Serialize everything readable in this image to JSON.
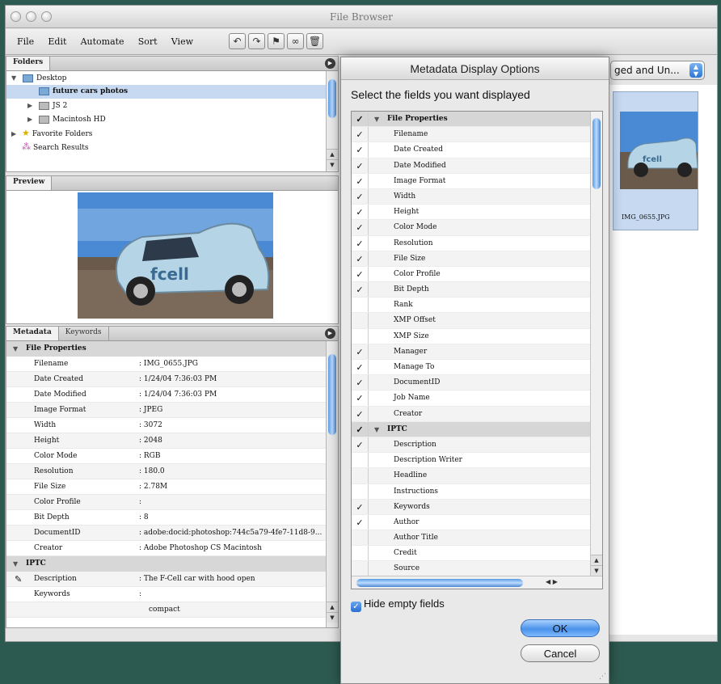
{
  "window": {
    "title": "File Browser"
  },
  "menu": [
    "File",
    "Edit",
    "Automate",
    "Sort",
    "View"
  ],
  "toolbar": {
    "icons": [
      "rotate-ccw-icon",
      "rotate-cw-icon",
      "flag-icon",
      "binoculars-icon",
      "trash-icon"
    ]
  },
  "folders": {
    "tab": "Folders",
    "items": [
      {
        "label": "Desktop",
        "expanded": true,
        "icon": "folder-icon"
      },
      {
        "label": "future cars photos",
        "selected": true,
        "icon": "folder-icon"
      },
      {
        "label": "JS 2",
        "icon": "disk-icon"
      },
      {
        "label": "Macintosh HD",
        "icon": "disk-icon"
      },
      {
        "label": "Favorite Folders",
        "icon": "star-icon"
      },
      {
        "label": "Search Results",
        "icon": "search-results-icon"
      }
    ]
  },
  "preview": {
    "tab": "Preview"
  },
  "metadata": {
    "tabs": [
      "Metadata",
      "Keywords"
    ],
    "group_file": "File Properties",
    "rows": [
      {
        "key": "Filename",
        "value": ": IMG_0655.JPG"
      },
      {
        "key": "Date Created",
        "value": ": 1/24/04 7:36:03 PM"
      },
      {
        "key": "Date Modified",
        "value": ": 1/24/04 7:36:03 PM"
      },
      {
        "key": "Image Format",
        "value": ": JPEG"
      },
      {
        "key": "Width",
        "value": ": 3072"
      },
      {
        "key": "Height",
        "value": ": 2048"
      },
      {
        "key": "Color Mode",
        "value": ": RGB"
      },
      {
        "key": "Resolution",
        "value": ": 180.0"
      },
      {
        "key": "File Size",
        "value": ": 2.78M"
      },
      {
        "key": "Color Profile",
        "value": ":"
      },
      {
        "key": "Bit Depth",
        "value": ": 8"
      },
      {
        "key": "DocumentID",
        "value": ": adobe:docid:photoshop:744c5a79-4fe7-11d8-9..."
      },
      {
        "key": "Creator",
        "value": ": Adobe Photoshop CS Macintosh"
      }
    ],
    "group_iptc": "IPTC",
    "iptc_rows": [
      {
        "key": "Description",
        "value": ": The F-Cell car with hood open"
      },
      {
        "key": "Keywords",
        "value": ":"
      },
      {
        "key": "",
        "value": "compact"
      }
    ]
  },
  "view_select": {
    "value": "ged and Un..."
  },
  "thumbnail": {
    "label": "IMG_0655.JPG"
  },
  "dialog": {
    "title": "Metadata Display Options",
    "instruction": "Select the fields you want displayed",
    "fields": [
      {
        "label": "File Properties",
        "group": true,
        "checked": true
      },
      {
        "label": "Filename",
        "checked": true
      },
      {
        "label": "Date Created",
        "checked": true
      },
      {
        "label": "Date Modified",
        "checked": true
      },
      {
        "label": "Image Format",
        "checked": true
      },
      {
        "label": "Width",
        "checked": true
      },
      {
        "label": "Height",
        "checked": true
      },
      {
        "label": "Color Mode",
        "checked": true
      },
      {
        "label": "Resolution",
        "checked": true
      },
      {
        "label": "File Size",
        "checked": true
      },
      {
        "label": "Color Profile",
        "checked": true
      },
      {
        "label": "Bit Depth",
        "checked": true
      },
      {
        "label": "Rank",
        "checked": false
      },
      {
        "label": "XMP Offset",
        "checked": false
      },
      {
        "label": "XMP Size",
        "checked": false
      },
      {
        "label": "Manager",
        "checked": true
      },
      {
        "label": "Manage To",
        "checked": true
      },
      {
        "label": "DocumentID",
        "checked": true
      },
      {
        "label": "Job Name",
        "checked": true
      },
      {
        "label": "Creator",
        "checked": true
      },
      {
        "label": "IPTC",
        "group": true,
        "checked": true
      },
      {
        "label": "Description",
        "checked": true
      },
      {
        "label": "Description Writer",
        "checked": false
      },
      {
        "label": "Headline",
        "checked": false
      },
      {
        "label": "Instructions",
        "checked": false
      },
      {
        "label": "Keywords",
        "checked": true
      },
      {
        "label": "Author",
        "checked": true
      },
      {
        "label": "Author Title",
        "checked": false
      },
      {
        "label": "Credit",
        "checked": false
      },
      {
        "label": "Source",
        "checked": false
      }
    ],
    "hide_empty": {
      "label": "Hide empty fields",
      "checked": true
    },
    "ok_label": "OK",
    "cancel_label": "Cancel"
  },
  "colors": {
    "selection": "#c6d9f1",
    "aqua": "#4a92ea",
    "desktop": "#2d5a50"
  }
}
